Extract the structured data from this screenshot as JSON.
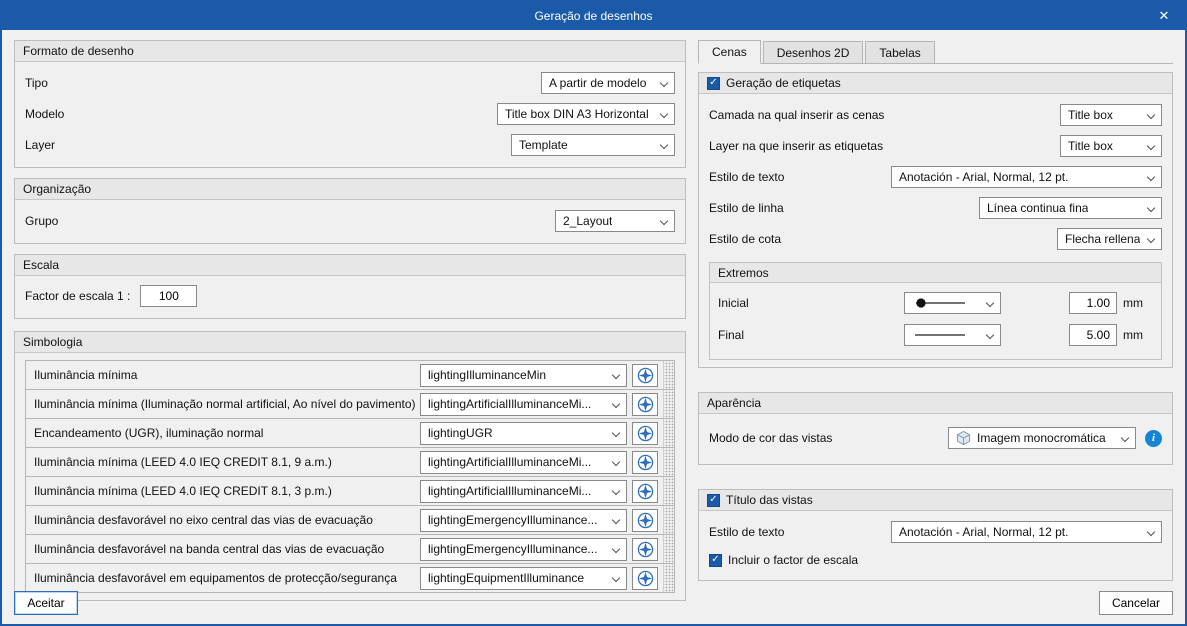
{
  "window": {
    "title": "Geração de desenhos"
  },
  "icons": {
    "close": "✕",
    "check": "✓",
    "info": "i"
  },
  "footer": {
    "accept_label": "Aceitar",
    "cancel_label": "Cancelar"
  },
  "left": {
    "formato": {
      "title": "Formato de desenho",
      "tipo_label": "Tipo",
      "tipo_value": "A partir de modelo",
      "modelo_label": "Modelo",
      "modelo_value": "Title box DIN A3 Horizontal",
      "layer_label": "Layer",
      "layer_value": "Template"
    },
    "organizacao": {
      "title": "Organização",
      "grupo_label": "Grupo",
      "grupo_value": "2_Layout"
    },
    "escala": {
      "title": "Escala",
      "factor_label": "Factor de escala 1 :",
      "factor_value": "100"
    },
    "simbologia": {
      "title": "Simbologia",
      "rows": [
        {
          "label": "Iluminância mínima",
          "value": "lightingIlluminanceMin"
        },
        {
          "label": "Iluminância mínima (Iluminação normal artificial, Ao nível do pavimento)",
          "value": "lightingArtificialIlluminanceMi..."
        },
        {
          "label": "Encandeamento (UGR), iluminação normal",
          "value": "lightingUGR"
        },
        {
          "label": "Iluminância mínima (LEED 4.0 IEQ CREDIT 8.1, 9 a.m.)",
          "value": "lightingArtificialIlluminanceMi..."
        },
        {
          "label": "Iluminância mínima (LEED 4.0 IEQ CREDIT 8.1, 3 p.m.)",
          "value": "lightingArtificialIlluminanceMi..."
        },
        {
          "label": "Iluminância desfavorável no eixo central das vias de evacuação",
          "value": "lightingEmergencyIlluminance..."
        },
        {
          "label": "Iluminância desfavorável na banda central das vias de evacuação",
          "value": "lightingEmergencyIlluminance..."
        },
        {
          "label": "Iluminância desfavorável em equipamentos de protecção/segurança",
          "value": "lightingEquipmentIlluminance"
        }
      ]
    }
  },
  "right": {
    "tabs": {
      "cenas": "Cenas",
      "desenhos2d": "Desenhos 2D",
      "tabelas": "Tabelas"
    },
    "etiquetas": {
      "title": "Geração de etiquetas",
      "camada_label": "Camada na qual inserir as cenas",
      "camada_value": "Title box",
      "layer_label": "Layer na que inserir as etiquetas",
      "layer_value": "Title box",
      "texto_label": "Estilo de texto",
      "texto_value": "Anotación - Arial, Normal, 12 pt.",
      "linha_label": "Estilo de linha",
      "linha_value": "Línea continua fina",
      "cota_label": "Estilo de cota",
      "cota_value": "Flecha rellena"
    },
    "extremos": {
      "title": "Extremos",
      "inicial_label": "Inicial",
      "inicial_value": "1.00",
      "inicial_unit": "mm",
      "inicial_icon": "line-with-start-dot",
      "final_label": "Final",
      "final_value": "5.00",
      "final_unit": "mm",
      "final_icon": "plain-line"
    },
    "aparencia": {
      "title": "Aparência",
      "modo_label": "Modo de cor das vistas",
      "modo_value": "Imagem monocromática"
    },
    "titulo": {
      "title": "Título das vistas",
      "texto_label": "Estilo de texto",
      "texto_value": "Anotación - Arial, Normal, 12 pt.",
      "incluir_label": "Incluir o factor de escala"
    }
  },
  "colors": {
    "titlebar": "#1a5aa8",
    "accent": "#2e6fbe",
    "info": "#1583d6"
  }
}
